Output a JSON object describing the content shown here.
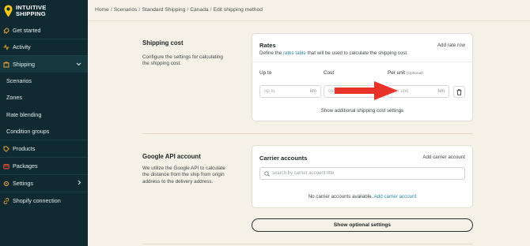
{
  "brand": {
    "line1": "INTUITIVE",
    "line2": "SHIPPING"
  },
  "sidebar": {
    "items": [
      {
        "label": "Get started",
        "icon": "rocket-icon"
      },
      {
        "label": "Activity",
        "icon": "activity-icon"
      },
      {
        "label": "Shipping",
        "icon": "shipping-box-icon"
      },
      {
        "label": "Scenarios"
      },
      {
        "label": "Zones"
      },
      {
        "label": "Rate blending"
      },
      {
        "label": "Condition groups"
      },
      {
        "label": "Products",
        "icon": "tag-icon"
      },
      {
        "label": "Packages",
        "icon": "package-icon"
      },
      {
        "label": "Settings",
        "icon": "gear-icon"
      },
      {
        "label": "Shopify connection",
        "icon": "link-icon"
      }
    ]
  },
  "breadcrumb": [
    "Home",
    "Scenarios",
    "Standard Shipping",
    "Canada",
    "Edit shipping method"
  ],
  "shipping_cost": {
    "title": "Shipping cost",
    "description_line1": "Configure the settings for calculating",
    "description_line2": "the shipping cost."
  },
  "rates": {
    "title": "Rates",
    "add_label": "Add rate row",
    "desc_prefix": "Define the",
    "desc_link": "rates table",
    "desc_suffix": "that will be used to calculate the shipping cost.",
    "col_upto": "Up to",
    "col_cost": "Cost",
    "col_perunit": "Per unit",
    "col_optional": "(Optional)",
    "upto_placeholder": "up to",
    "upto_unit": "km",
    "cost_placeholder": "cost",
    "perunit_placeholder": "per unit",
    "perunit_unit": "km",
    "show_additional": "Show additional shipping cost settings"
  },
  "google": {
    "title": "Google API account",
    "description_line1": "We utilize the Google API to calculate",
    "description_line2": "the distance from the ship from origin",
    "description_line3": "address to the delivery address."
  },
  "carrier": {
    "title": "Carrier accounts",
    "add_label": "Add carrier account",
    "search_placeholder": "search by carrier account title",
    "empty_text": "No carrier accounts available.",
    "empty_link": "Add carrier account"
  },
  "optional_button": "Show optional settings",
  "colors": {
    "sidebar_bg": "#0f2a30",
    "page_bg": "#f6f1e7",
    "link": "#2a86a6",
    "annotation_arrow": "#e8332a",
    "brand_pin": "#f5c518"
  }
}
